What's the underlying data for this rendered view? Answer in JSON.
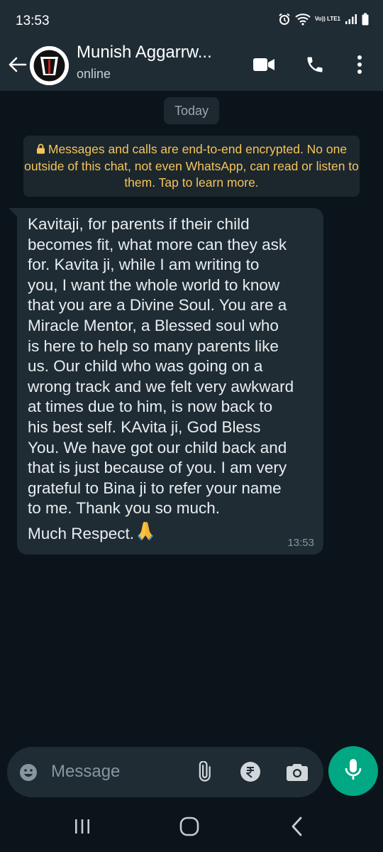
{
  "status_bar": {
    "time": "13:53",
    "network_label": "Vo)) LTE1",
    "icons": [
      "alarm-icon",
      "wifi-icon",
      "signal-icon",
      "battery-icon"
    ]
  },
  "header": {
    "contact_name": "Munish Aggarrw...",
    "contact_status": "online",
    "icons": [
      "back-arrow-icon",
      "video-call-icon",
      "voice-call-icon",
      "more-options-icon"
    ]
  },
  "chat": {
    "date_label": "Today",
    "encryption_notice": "Messages and calls are end-to-end encrypted. No one outside of this chat, not even WhatsApp, can read or listen to them. Tap to learn more.",
    "message": {
      "text": "Kavitaji, for parents if their child\nbecomes fit, what more can they ask\nfor. Kavita ji, while I am writing to\nyou, I want the whole world to know\nthat you are a Divine Soul. You are a\nMiracle Mentor, a Blessed soul who\nis here to help so many parents like\nus. Our child who was going on a\nwrong track and we felt very awkward\nat times due to him, is now back to\nhis best self. KAvita ji, God Bless\nYou. We have got our child back and\nthat is just because of you. I am very\ngrateful to Bina ji to refer your name\nto me. Thank you so much.",
      "sign_off": "Much Respect.",
      "emoji": "folded-hands-icon",
      "time": "13:53"
    }
  },
  "composer": {
    "placeholder": "Message",
    "icons": [
      "emoji-icon",
      "attach-icon",
      "rupee-payment-icon",
      "camera-icon",
      "mic-icon"
    ]
  },
  "nav_bar": {
    "icons": [
      "recent-apps-icon",
      "home-icon",
      "back-nav-icon"
    ]
  },
  "colors": {
    "app_bar": "#1f2c34",
    "background": "#0b141a",
    "incoming_bubble": "#1f2c34",
    "encryption_text": "#f4c55a",
    "accent": "#00a884"
  }
}
